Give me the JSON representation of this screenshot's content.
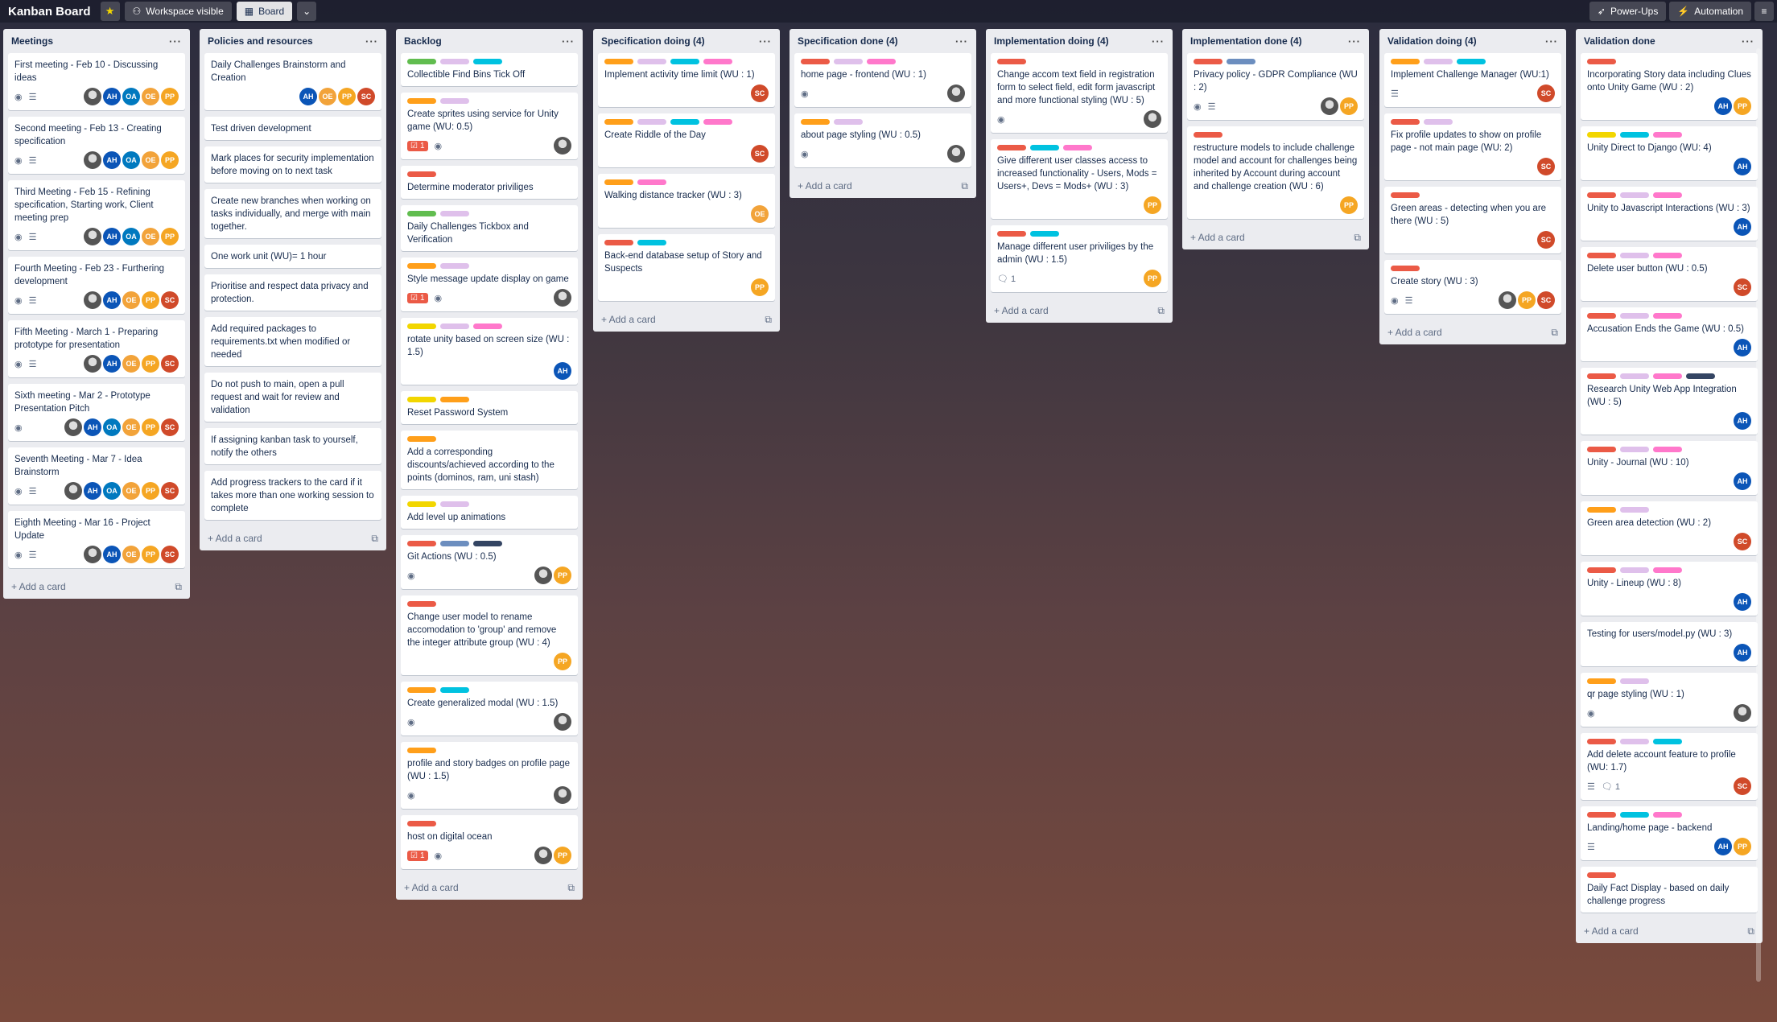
{
  "topbar": {
    "title": "Kanban Board",
    "workspace_label": "Workspace visible",
    "board_label": "Board",
    "powerups_label": "Power-Ups",
    "automation_label": "Automation"
  },
  "colors": {
    "green": "#61bd4f",
    "yellow": "#f2d600",
    "orange": "#ff9f1a",
    "red": "#eb5a46",
    "purple": "#c377e0",
    "blue": "#0079bf",
    "sky": "#00c2e0",
    "pink": "#ff78cb",
    "black": "#344563",
    "lightpurple": "#dfc0eb",
    "steel": "#6c8ebf"
  },
  "members": {
    "AH": "#0b55b7",
    "OA": "#0079bf",
    "OE": "#f2a33a",
    "PP": "#f5a623",
    "SC": "#d04a2a",
    "IMG": "#444"
  },
  "add_card_label": "+ Add a card",
  "lists": [
    {
      "title": "Meetings",
      "cards": [
        {
          "labels": [],
          "title": "First meeting - Feb 10 - Discussing ideas",
          "badges": [
            "eye",
            "desc"
          ],
          "members": [
            "IMG",
            "AH",
            "OA",
            "OE",
            "PP"
          ]
        },
        {
          "labels": [],
          "title": "Second meeting - Feb 13 - Creating specification",
          "badges": [
            "eye",
            "desc"
          ],
          "members": [
            "IMG",
            "AH",
            "OA",
            "OE",
            "PP"
          ]
        },
        {
          "labels": [],
          "title": "Third Meeting - Feb 15 - Refining specification, Starting work, Client meeting prep",
          "badges": [
            "eye",
            "desc"
          ],
          "members": [
            "IMG",
            "AH",
            "OA",
            "OE",
            "PP"
          ]
        },
        {
          "labels": [],
          "title": "Fourth Meeting - Feb 23 - Furthering development",
          "badges": [
            "eye",
            "desc"
          ],
          "members": [
            "IMG",
            "AH",
            "OE",
            "PP",
            "SC"
          ]
        },
        {
          "labels": [],
          "title": "Fifth Meeting - March 1 - Preparing prototype for presentation",
          "badges": [
            "eye",
            "desc"
          ],
          "members": [
            "IMG",
            "AH",
            "OE",
            "PP",
            "SC"
          ]
        },
        {
          "labels": [],
          "title": "Sixth meeting - Mar 2 - Prototype Presentation Pitch",
          "badges": [
            "eye"
          ],
          "members": [
            "IMG",
            "AH",
            "OA",
            "OE",
            "PP",
            "SC"
          ]
        },
        {
          "labels": [],
          "title": "Seventh Meeting - Mar 7 - Idea Brainstorm",
          "badges": [
            "eye",
            "desc"
          ],
          "members": [
            "IMG",
            "AH",
            "OA",
            "OE",
            "PP",
            "SC"
          ]
        },
        {
          "labels": [],
          "title": "Eighth Meeting - Mar 16 - Project Update",
          "badges": [
            "eye",
            "desc"
          ],
          "members": [
            "IMG",
            "AH",
            "OE",
            "PP",
            "SC"
          ]
        }
      ]
    },
    {
      "title": "Policies and resources",
      "cards": [
        {
          "labels": [],
          "title": "Daily Challenges Brainstorm and Creation",
          "badges": [],
          "members": [
            "AH",
            "OE",
            "PP",
            "SC"
          ]
        },
        {
          "labels": [],
          "title": "Test driven development",
          "badges": [],
          "members": []
        },
        {
          "labels": [],
          "title": "Mark places for security implementation before moving on to next task",
          "badges": [],
          "members": []
        },
        {
          "labels": [],
          "title": "Create new branches when working on tasks individually, and merge with main together.",
          "badges": [],
          "members": []
        },
        {
          "labels": [],
          "title": "One work unit (WU)= 1 hour",
          "badges": [],
          "members": []
        },
        {
          "labels": [],
          "title": "Prioritise and respect data privacy and protection.",
          "badges": [],
          "members": []
        },
        {
          "labels": [],
          "title": "Add required packages to requirements.txt when modified or needed",
          "badges": [],
          "members": []
        },
        {
          "labels": [],
          "title": "Do not push to main, open a pull request and wait for review and validation",
          "badges": [],
          "members": []
        },
        {
          "labels": [],
          "title": "If assigning kanban task to yourself, notify the others",
          "badges": [],
          "members": []
        },
        {
          "labels": [],
          "title": "Add progress trackers to the card if it takes more than one working session to complete",
          "badges": [],
          "members": []
        }
      ]
    },
    {
      "title": "Backlog",
      "cards": [
        {
          "labels": [
            "green",
            "lightpurple",
            "sky"
          ],
          "title": "Collectible Find Bins Tick Off",
          "badges": [],
          "members": []
        },
        {
          "labels": [
            "orange",
            "lightpurple"
          ],
          "title": "Create sprites using service for Unity game (WU: 0.5)",
          "badges": [
            "red1",
            "eye"
          ],
          "members": [
            "IMG"
          ]
        },
        {
          "labels": [
            "red"
          ],
          "title": "Determine moderator priviliges",
          "badges": [],
          "members": []
        },
        {
          "labels": [
            "green",
            "lightpurple"
          ],
          "title": "Daily Challenges Tickbox and Verification",
          "badges": [],
          "members": []
        },
        {
          "labels": [
            "orange",
            "lightpurple"
          ],
          "title": "Style message update display on game",
          "badges": [
            "red1",
            "eye"
          ],
          "members": [
            "IMG"
          ]
        },
        {
          "labels": [
            "yellow",
            "lightpurple",
            "pink"
          ],
          "title": "rotate unity based on screen size (WU : 1.5)",
          "badges": [],
          "members": [
            "AH"
          ]
        },
        {
          "labels": [
            "yellow",
            "orange"
          ],
          "title": "Reset Password System",
          "badges": [],
          "members": []
        },
        {
          "labels": [
            "orange"
          ],
          "title": "Add a corresponding discounts/achieved according to the points (dominos, ram, uni stash)",
          "badges": [],
          "members": []
        },
        {
          "labels": [
            "yellow",
            "lightpurple"
          ],
          "title": "Add level up animations",
          "badges": [],
          "members": []
        },
        {
          "labels": [
            "red",
            "steel",
            "black"
          ],
          "title": "Git Actions (WU : 0.5)",
          "badges": [
            "eye"
          ],
          "members": [
            "IMG",
            "PP"
          ]
        },
        {
          "labels": [
            "red"
          ],
          "title": "Change user model to rename accomodation to 'group' and remove the integer attribute group (WU : 4)",
          "badges": [],
          "members": [
            "PP"
          ]
        },
        {
          "labels": [
            "orange",
            "sky"
          ],
          "title": "Create generalized modal (WU : 1.5)",
          "badges": [
            "eye"
          ],
          "members": [
            "IMG"
          ]
        },
        {
          "labels": [
            "orange"
          ],
          "title": "profile and story badges on profile page (WU : 1.5)",
          "badges": [
            "eye"
          ],
          "members": [
            "IMG"
          ]
        },
        {
          "labels": [
            "red"
          ],
          "title": "host on digital ocean",
          "badges": [
            "red1",
            "eye"
          ],
          "members": [
            "IMG",
            "PP"
          ]
        }
      ]
    },
    {
      "title": "Specification doing (4)",
      "cards": [
        {
          "labels": [
            "orange",
            "lightpurple",
            "sky",
            "pink"
          ],
          "title": "Implement activity time limit (WU : 1)",
          "badges": [],
          "members": [
            "SC"
          ]
        },
        {
          "labels": [
            "orange",
            "lightpurple",
            "sky",
            "pink"
          ],
          "title": "Create Riddle of the Day",
          "badges": [],
          "members": [
            "SC"
          ]
        },
        {
          "labels": [
            "orange",
            "pink"
          ],
          "title": "Walking distance tracker (WU : 3)",
          "badges": [],
          "members": [
            "OE"
          ]
        },
        {
          "labels": [
            "red",
            "sky"
          ],
          "title": "Back-end database setup of Story and Suspects",
          "badges": [],
          "members": [
            "PP"
          ]
        }
      ]
    },
    {
      "title": "Specification done (4)",
      "cards": [
        {
          "labels": [
            "red",
            "lightpurple",
            "pink"
          ],
          "title": "home page - frontend (WU : 1)",
          "badges": [
            "eye"
          ],
          "members": [
            "IMG"
          ]
        },
        {
          "labels": [
            "orange",
            "lightpurple"
          ],
          "title": "about page styling (WU : 0.5)",
          "badges": [
            "eye"
          ],
          "members": [
            "IMG"
          ]
        }
      ]
    },
    {
      "title": "Implementation doing (4)",
      "cards": [
        {
          "labels": [
            "red"
          ],
          "title": "Change accom text field in registration form to select field, edit form javascript and more functional styling (WU : 5)",
          "badges": [
            "eye"
          ],
          "members": [
            "IMG"
          ]
        },
        {
          "labels": [
            "red",
            "sky",
            "pink"
          ],
          "title": "Give different user classes access to increased functionality - Users, Mods = Users+, Devs = Mods+ (WU : 3)",
          "badges": [],
          "members": [
            "PP"
          ]
        },
        {
          "labels": [
            "red",
            "sky"
          ],
          "title": "Manage different user priviliges by the admin (WU : 1.5)",
          "badges": [
            "comment1"
          ],
          "members": [
            "PP"
          ]
        }
      ]
    },
    {
      "title": "Implementation done (4)",
      "cards": [
        {
          "labels": [
            "red",
            "steel"
          ],
          "title": "Privacy policy - GDPR Compliance (WU : 2)",
          "badges": [
            "eye",
            "desc"
          ],
          "members": [
            "IMG",
            "PP"
          ]
        },
        {
          "labels": [
            "red"
          ],
          "title": "restructure models to include challenge model and account for challenges being inherited by Account during account and challenge creation (WU : 6)",
          "badges": [],
          "members": [
            "PP"
          ]
        }
      ]
    },
    {
      "title": "Validation doing (4)",
      "cards": [
        {
          "labels": [
            "orange",
            "lightpurple",
            "sky"
          ],
          "title": "Implement Challenge Manager (WU:1)",
          "badges": [
            "desc"
          ],
          "members": [
            "SC"
          ]
        },
        {
          "labels": [
            "red",
            "lightpurple"
          ],
          "title": "Fix profile updates to show on profile page - not main page (WU: 2)",
          "badges": [],
          "members": [
            "SC"
          ]
        },
        {
          "labels": [
            "red"
          ],
          "title": "Green areas - detecting when you are there (WU : 5)",
          "badges": [],
          "members": [
            "SC"
          ]
        },
        {
          "labels": [
            "red"
          ],
          "title": "Create story (WU : 3)",
          "badges": [
            "eye",
            "desc"
          ],
          "members": [
            "IMG",
            "PP",
            "SC"
          ]
        }
      ]
    },
    {
      "title": "Validation done",
      "cards": [
        {
          "labels": [
            "red"
          ],
          "title": "Incorporating Story data including Clues onto Unity Game (WU : 2)",
          "badges": [],
          "members": [
            "AH",
            "PP"
          ]
        },
        {
          "labels": [
            "yellow",
            "sky",
            "pink"
          ],
          "title": "Unity Direct to Django (WU: 4)",
          "badges": [],
          "members": [
            "AH"
          ]
        },
        {
          "labels": [
            "red",
            "lightpurple",
            "pink"
          ],
          "title": "Unity to Javascript Interactions (WU : 3)",
          "badges": [],
          "members": [
            "AH"
          ]
        },
        {
          "labels": [
            "red",
            "lightpurple",
            "pink"
          ],
          "title": "Delete user button (WU : 0.5)",
          "badges": [],
          "members": [
            "SC"
          ]
        },
        {
          "labels": [
            "red",
            "lightpurple",
            "pink"
          ],
          "title": "Accusation Ends the Game (WU : 0.5)",
          "badges": [],
          "members": [
            "AH"
          ]
        },
        {
          "labels": [
            "red",
            "lightpurple",
            "pink",
            "black"
          ],
          "title": "Research Unity Web App Integration (WU : 5)",
          "badges": [],
          "members": [
            "AH"
          ]
        },
        {
          "labels": [
            "red",
            "lightpurple",
            "pink"
          ],
          "title": "Unity - Journal (WU : 10)",
          "badges": [],
          "members": [
            "AH"
          ]
        },
        {
          "labels": [
            "orange",
            "lightpurple"
          ],
          "title": "Green area detection (WU : 2)",
          "badges": [],
          "members": [
            "SC"
          ]
        },
        {
          "labels": [
            "red",
            "lightpurple",
            "pink"
          ],
          "title": "Unity - Lineup (WU : 8)",
          "badges": [],
          "members": [
            "AH"
          ]
        },
        {
          "labels": [],
          "title": "Testing for users/model.py (WU : 3)",
          "badges": [],
          "members": [
            "AH"
          ]
        },
        {
          "labels": [
            "orange",
            "lightpurple"
          ],
          "title": "qr page styling (WU : 1)",
          "badges": [
            "eye"
          ],
          "members": [
            "IMG"
          ]
        },
        {
          "labels": [
            "red",
            "lightpurple",
            "sky"
          ],
          "title": "Add delete account feature to profile (WU: 1.7)",
          "badges": [
            "desc",
            "comment1"
          ],
          "members": [
            "SC"
          ]
        },
        {
          "labels": [
            "red",
            "sky",
            "pink"
          ],
          "title": "Landing/home page - backend",
          "badges": [
            "desc"
          ],
          "members": [
            "AH",
            "PP"
          ]
        },
        {
          "labels": [
            "red"
          ],
          "title": "Daily Fact Display - based on daily challenge progress",
          "badges": [],
          "members": []
        }
      ]
    }
  ]
}
